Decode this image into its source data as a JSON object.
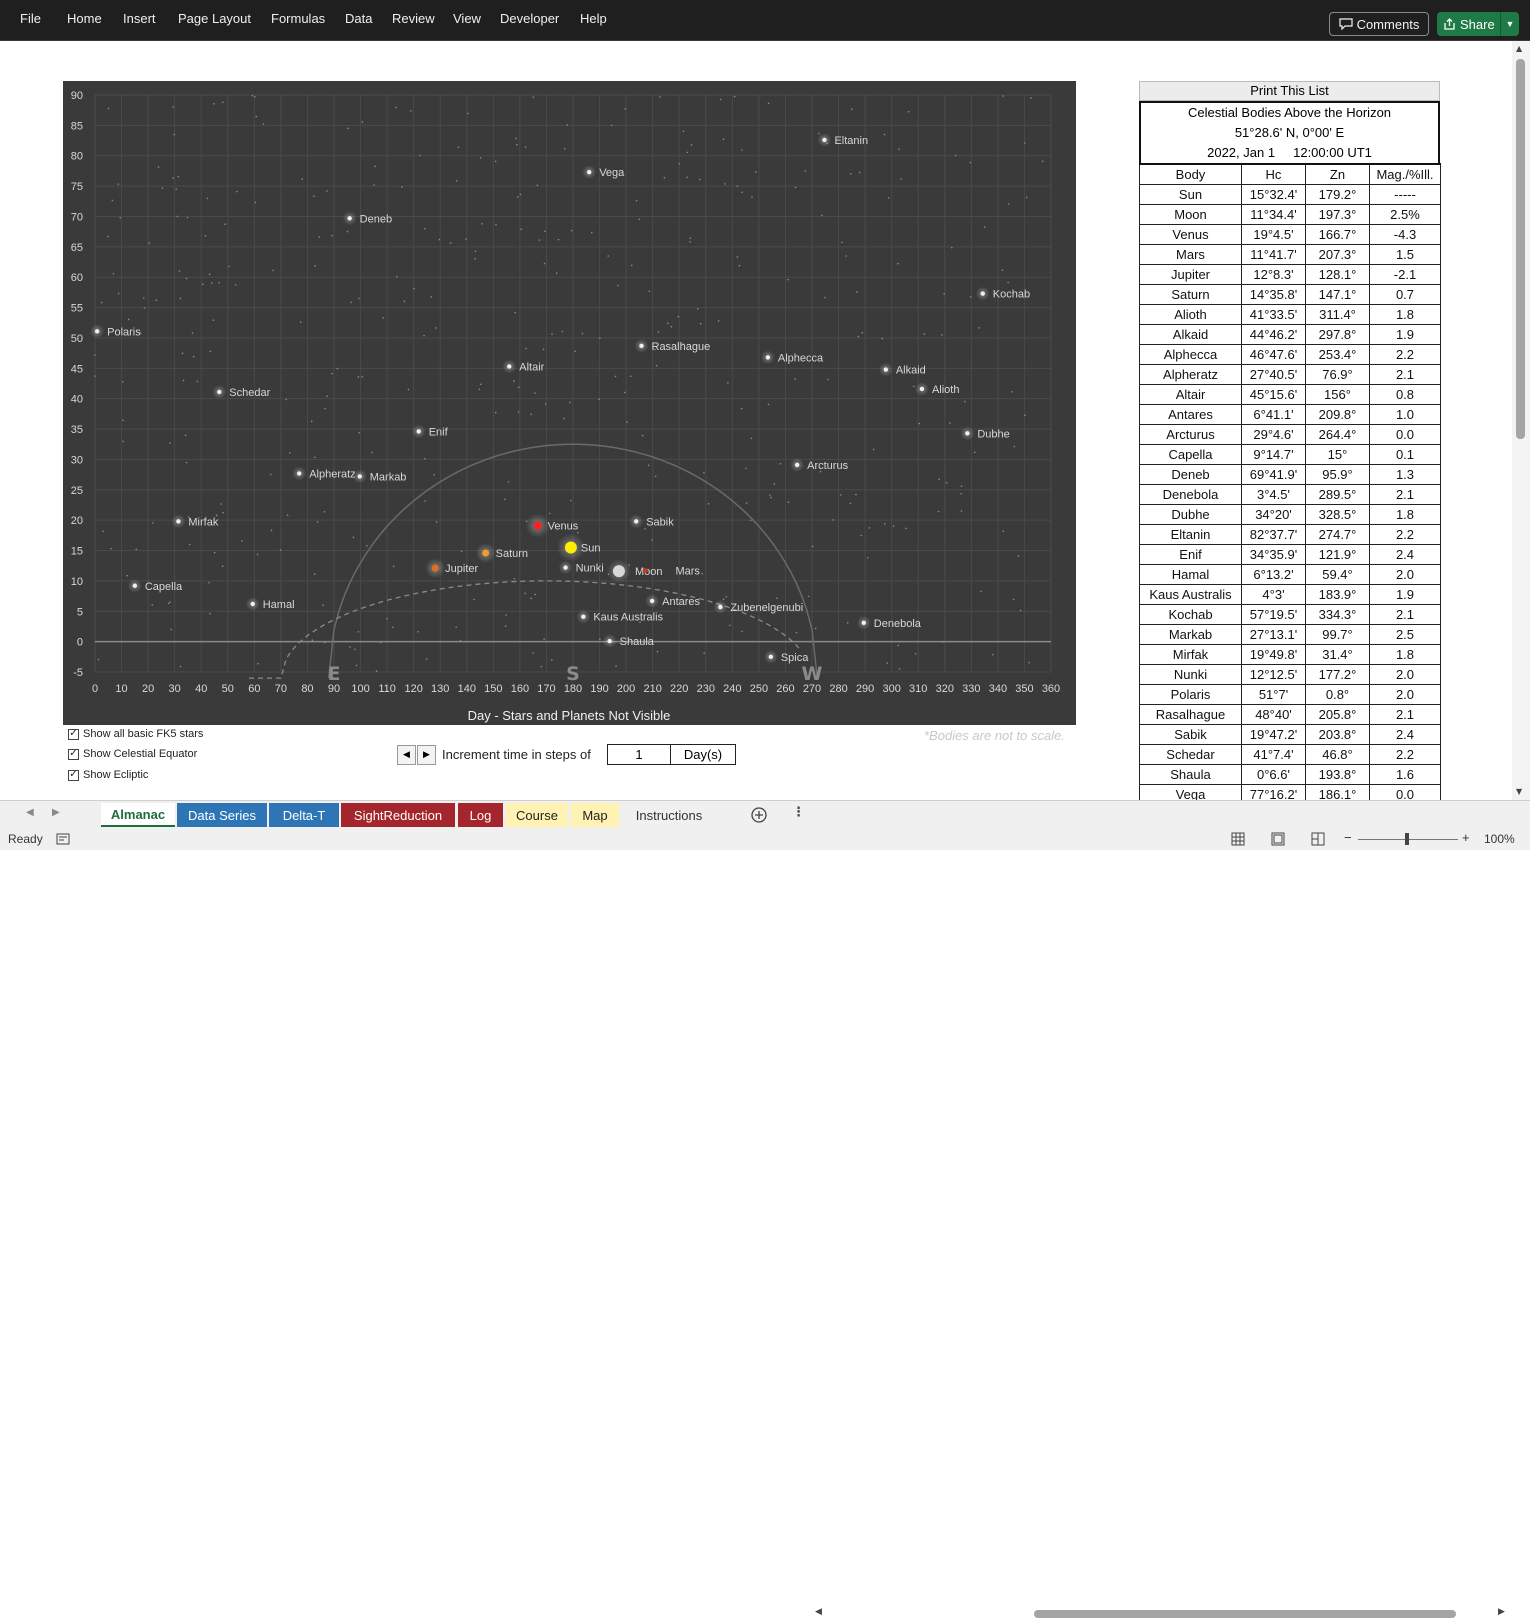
{
  "menu": [
    "File",
    "Home",
    "Insert",
    "Page Layout",
    "Formulas",
    "Data",
    "Review",
    "View",
    "Developer",
    "Help"
  ],
  "buttons": {
    "comments": "Comments",
    "share": "Share"
  },
  "chart": {
    "caption": "Day - Stars and Planets Not Visible",
    "cardinals": [
      "E",
      "S",
      "W"
    ],
    "scale_note": "*Bodies are not to scale.",
    "colors": {
      "background": "#3a3a3a",
      "sun": "#ffee00",
      "venus": "#ff2020",
      "jupiter": "#e07020",
      "saturn": "#f0a020",
      "moon": "#d8d8d8",
      "star": "#f0f0f0",
      "text": "#d8d8d8"
    }
  },
  "chart_data": {
    "type": "scatter",
    "title": "",
    "xlabel": "Day - Stars and Planets Not Visible",
    "ylabel": "",
    "xlim": [
      0,
      360
    ],
    "ylim": [
      -5,
      90
    ],
    "xticks": [
      0,
      10,
      20,
      30,
      40,
      50,
      60,
      70,
      80,
      90,
      100,
      110,
      120,
      130,
      140,
      150,
      160,
      170,
      180,
      190,
      200,
      210,
      220,
      230,
      240,
      250,
      260,
      270,
      280,
      290,
      300,
      310,
      320,
      330,
      340,
      350,
      360
    ],
    "yticks": [
      -5,
      0,
      5,
      10,
      15,
      20,
      25,
      30,
      35,
      40,
      45,
      50,
      55,
      60,
      65,
      70,
      75,
      80,
      85,
      90
    ],
    "grid": true,
    "points": [
      {
        "name": "Sun",
        "x": 179.2,
        "y": 15.5,
        "kind": "sun"
      },
      {
        "name": "Moon",
        "x": 197.3,
        "y": 11.6,
        "kind": "moon"
      },
      {
        "name": "Venus",
        "x": 166.7,
        "y": 19.1,
        "kind": "venus"
      },
      {
        "name": "Mars",
        "x": 207.3,
        "y": 11.7,
        "kind": "mars"
      },
      {
        "name": "Jupiter",
        "x": 128.1,
        "y": 12.1,
        "kind": "jupiter"
      },
      {
        "name": "Saturn",
        "x": 147.1,
        "y": 14.6,
        "kind": "saturn"
      },
      {
        "name": "Alioth",
        "x": 311.4,
        "y": 41.6,
        "kind": "star"
      },
      {
        "name": "Alkaid",
        "x": 297.8,
        "y": 44.8,
        "kind": "star"
      },
      {
        "name": "Alphecca",
        "x": 253.4,
        "y": 46.8,
        "kind": "star"
      },
      {
        "name": "Alpheratz",
        "x": 76.9,
        "y": 27.7,
        "kind": "star"
      },
      {
        "name": "Altair",
        "x": 156,
        "y": 45.3,
        "kind": "star"
      },
      {
        "name": "Antares",
        "x": 209.8,
        "y": 6.7,
        "kind": "star"
      },
      {
        "name": "Arcturus",
        "x": 264.4,
        "y": 29.1,
        "kind": "star"
      },
      {
        "name": "Capella",
        "x": 15,
        "y": 9.2,
        "kind": "star"
      },
      {
        "name": "Deneb",
        "x": 95.9,
        "y": 69.7,
        "kind": "star"
      },
      {
        "name": "Denebola",
        "x": 289.5,
        "y": 3.1,
        "kind": "star"
      },
      {
        "name": "Dubhe",
        "x": 328.5,
        "y": 34.3,
        "kind": "star"
      },
      {
        "name": "Eltanin",
        "x": 274.7,
        "y": 82.6,
        "kind": "star"
      },
      {
        "name": "Enif",
        "x": 121.9,
        "y": 34.6,
        "kind": "star"
      },
      {
        "name": "Hamal",
        "x": 59.4,
        "y": 6.2,
        "kind": "star"
      },
      {
        "name": "Kaus Australis",
        "x": 183.9,
        "y": 4.1,
        "kind": "star"
      },
      {
        "name": "Kochab",
        "x": 334.3,
        "y": 57.3,
        "kind": "star"
      },
      {
        "name": "Markab",
        "x": 99.7,
        "y": 27.2,
        "kind": "star"
      },
      {
        "name": "Mirfak",
        "x": 31.4,
        "y": 19.8,
        "kind": "star"
      },
      {
        "name": "Nunki",
        "x": 177.2,
        "y": 12.2,
        "kind": "star"
      },
      {
        "name": "Polaris",
        "x": 0.8,
        "y": 51.1,
        "kind": "star"
      },
      {
        "name": "Rasalhague",
        "x": 205.8,
        "y": 48.7,
        "kind": "star"
      },
      {
        "name": "Sabik",
        "x": 203.8,
        "y": 19.8,
        "kind": "star"
      },
      {
        "name": "Schedar",
        "x": 46.8,
        "y": 41.1,
        "kind": "star"
      },
      {
        "name": "Shaula",
        "x": 193.8,
        "y": 0.1,
        "kind": "star"
      },
      {
        "name": "Vega",
        "x": 186.1,
        "y": 77.3,
        "kind": "star"
      },
      {
        "name": "Spica",
        "x": 254.5,
        "y": -2.5,
        "kind": "star"
      },
      {
        "name": "Zubenelgenubi",
        "x": 235.5,
        "y": 5.7,
        "kind": "star"
      }
    ]
  },
  "checkboxes": [
    {
      "label": "Show all basic FK5 stars",
      "checked": true
    },
    {
      "label": "Show Celestial Equator",
      "checked": true
    },
    {
      "label": "Show Ecliptic",
      "checked": true
    }
  ],
  "increment": {
    "label": "Increment time in steps of",
    "value": "1",
    "unit": "Day(s)"
  },
  "list": {
    "print_button": "Print This List",
    "title": "Celestial Bodies Above the Horizon",
    "position": "51°28.6' N, 0°00' E",
    "datetime": "2022, Jan 1     12:00:00 UT1",
    "columns": [
      "Body",
      "Hc",
      "Zn",
      "Mag./%Ill."
    ],
    "rows": [
      [
        "Sun",
        "15°32.4'",
        "179.2°",
        "-----"
      ],
      [
        "Moon",
        "11°34.4'",
        "197.3°",
        "2.5%"
      ],
      [
        "Venus",
        "19°4.5'",
        "166.7°",
        "-4.3"
      ],
      [
        "Mars",
        "11°41.7'",
        "207.3°",
        "1.5"
      ],
      [
        "Jupiter",
        "12°8.3'",
        "128.1°",
        "-2.1"
      ],
      [
        "Saturn",
        "14°35.8'",
        "147.1°",
        "0.7"
      ],
      [
        "Alioth",
        "41°33.5'",
        "311.4°",
        "1.8"
      ],
      [
        "Alkaid",
        "44°46.2'",
        "297.8°",
        "1.9"
      ],
      [
        "Alphecca",
        "46°47.6'",
        "253.4°",
        "2.2"
      ],
      [
        "Alpheratz",
        "27°40.5'",
        "76.9°",
        "2.1"
      ],
      [
        "Altair",
        "45°15.6'",
        "156°",
        "0.8"
      ],
      [
        "Antares",
        "6°41.1'",
        "209.8°",
        "1.0"
      ],
      [
        "Arcturus",
        "29°4.6'",
        "264.4°",
        "0.0"
      ],
      [
        "Capella",
        "9°14.7'",
        "15°",
        "0.1"
      ],
      [
        "Deneb",
        "69°41.9'",
        "95.9°",
        "1.3"
      ],
      [
        "Denebola",
        "3°4.5'",
        "289.5°",
        "2.1"
      ],
      [
        "Dubhe",
        "34°20'",
        "328.5°",
        "1.8"
      ],
      [
        "Eltanin",
        "82°37.7'",
        "274.7°",
        "2.2"
      ],
      [
        "Enif",
        "34°35.9'",
        "121.9°",
        "2.4"
      ],
      [
        "Hamal",
        "6°13.2'",
        "59.4°",
        "2.0"
      ],
      [
        "Kaus Australis",
        "4°3'",
        "183.9°",
        "1.9"
      ],
      [
        "Kochab",
        "57°19.5'",
        "334.3°",
        "2.1"
      ],
      [
        "Markab",
        "27°13.1'",
        "99.7°",
        "2.5"
      ],
      [
        "Mirfak",
        "19°49.8'",
        "31.4°",
        "1.8"
      ],
      [
        "Nunki",
        "12°12.5'",
        "177.2°",
        "2.0"
      ],
      [
        "Polaris",
        "51°7'",
        "0.8°",
        "2.0"
      ],
      [
        "Rasalhague",
        "48°40'",
        "205.8°",
        "2.1"
      ],
      [
        "Sabik",
        "19°47.2'",
        "203.8°",
        "2.4"
      ],
      [
        "Schedar",
        "41°7.4'",
        "46.8°",
        "2.2"
      ],
      [
        "Shaula",
        "0°6.6'",
        "193.8°",
        "1.6"
      ],
      [
        "Vega",
        "77°16.2'",
        "186.1°",
        "0.0"
      ]
    ]
  },
  "tabs": [
    {
      "label": "Almanac",
      "bg": "#ffffff",
      "color": "#1e6e3a",
      "active": true
    },
    {
      "label": "Data Series",
      "bg": "#2e75b6",
      "color": "#ffffff"
    },
    {
      "label": "Delta-T",
      "bg": "#2e75b6",
      "color": "#ffffff"
    },
    {
      "label": "SightReduction",
      "bg": "#a4262c",
      "color": "#ffffff"
    },
    {
      "label": "Log",
      "bg": "#a4262c",
      "color": "#ffffff"
    },
    {
      "label": "Course",
      "bg": "#fff2b3",
      "color": "#222222"
    },
    {
      "label": "Map",
      "bg": "#fff2b3",
      "color": "#222222"
    },
    {
      "label": "Instructions",
      "bg": "#f0f0f0",
      "color": "#333333"
    }
  ],
  "status": {
    "ready": "Ready",
    "zoom": "100%"
  }
}
